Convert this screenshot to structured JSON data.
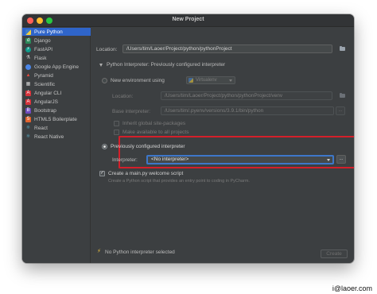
{
  "window": {
    "title": "New Project"
  },
  "sidebar": {
    "items": [
      {
        "label": "Pure Python",
        "icon": "python-icon",
        "selected": true
      },
      {
        "label": "Django",
        "icon": "django-icon"
      },
      {
        "label": "FastAPI",
        "icon": "fastapi-icon"
      },
      {
        "label": "Flask",
        "icon": "flask-icon"
      },
      {
        "label": "Google App Engine",
        "icon": "google-app-engine-icon"
      },
      {
        "label": "Pyramid",
        "icon": "pyramid-icon"
      },
      {
        "label": "Scientific",
        "icon": "scientific-icon"
      },
      {
        "label": "Angular CLI",
        "icon": "angular-icon"
      },
      {
        "label": "AngularJS",
        "icon": "angularjs-icon"
      },
      {
        "label": "Bootstrap",
        "icon": "bootstrap-icon"
      },
      {
        "label": "HTML5 Boilerplate",
        "icon": "html5-icon"
      },
      {
        "label": "React",
        "icon": "react-icon"
      },
      {
        "label": "React Native",
        "icon": "react-native-icon"
      }
    ]
  },
  "main": {
    "location_label": "Location:",
    "location_value": "/Users/tim/Laoer/Project/python/pythonProject",
    "section_title": "Python Interpreter: Previously configured interpreter",
    "new_env": {
      "radio_label": "New environment using",
      "tool_value": "Virtualenv",
      "location_label": "Location:",
      "location_value": "/Users/tim/Laoer/Project/python/pythonProject/venv",
      "base_label": "Base interpreter:",
      "base_value": "/Users/tim/.pyenv/versions/3.9.1/bin/python",
      "inherit_label": "Inherit global site-packages",
      "available_label": "Make available to all projects"
    },
    "previous": {
      "radio_label": "Previously configured interpreter",
      "interpreter_label": "Interpreter:",
      "interpreter_value": "<No interpreter>"
    },
    "welcome": {
      "checkbox_label": "Create a main.py welcome script",
      "description": "Create a Python script that provides an entry point to coding in PyCharm."
    },
    "warning_text": "No Python interpreter selected",
    "create_label": "Create",
    "browse_glyph": "..."
  },
  "watermark": "i@laoer.com",
  "colors": {
    "accent": "#2f65ca",
    "highlight_frame": "#d41f2a",
    "focus_border": "#3d77c9",
    "warning": "#f0c43f"
  }
}
